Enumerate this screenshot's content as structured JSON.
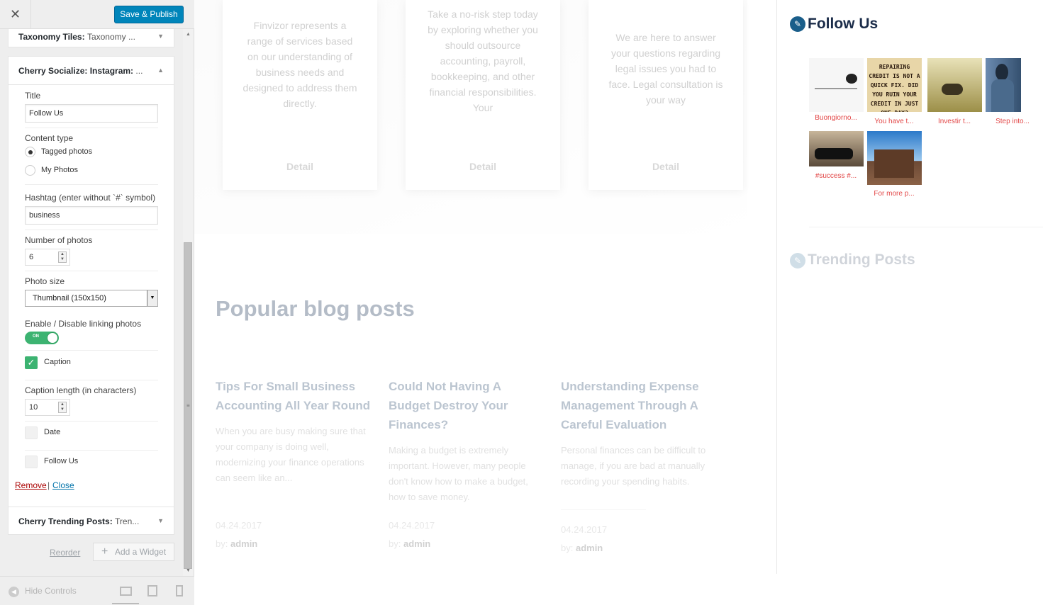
{
  "topbar": {
    "close_glyph": "✕",
    "publish_label": "Save & Publish"
  },
  "widgets": {
    "taxonomy": {
      "title": "Taxonomy Tiles:",
      "subtitle": "Taxonomy ..."
    },
    "instagram": {
      "title": "Cherry Socialize: Instagram:",
      "subtitle": "...",
      "title_label": "Title",
      "title_value": "Follow Us",
      "content_type_label": "Content type",
      "content_types": [
        "Tagged photos",
        "My Photos"
      ],
      "content_type_selected": "Tagged photos",
      "hashtag_label": "Hashtag (enter without `#` symbol)",
      "hashtag_value": "business",
      "num_photos_label": "Number of photos",
      "num_photos_value": "6",
      "photo_size_label": "Photo size",
      "photo_size_value": "Thumbnail (150x150)",
      "linking_label": "Enable / Disable linking photos",
      "linking_toggle": "ON",
      "caption_label": "Caption",
      "caption_checked": true,
      "caption_length_label": "Caption length (in characters)",
      "caption_length_value": "10",
      "date_label": "Date",
      "date_checked": false,
      "follow_label": "Follow Us",
      "follow_checked": false,
      "remove_link": "Remove",
      "divider": "|",
      "close_link": "Close"
    },
    "trending": {
      "title": "Cherry Trending Posts:",
      "subtitle": "Tren..."
    }
  },
  "actions": {
    "reorder": "Reorder",
    "add_widget": "Add a Widget"
  },
  "footer": {
    "hide_controls": "Hide Controls"
  },
  "preview": {
    "services": [
      {
        "text": "Finvizor represents a range of services based on our understanding of business needs and designed to address them directly.",
        "button": "Detail"
      },
      {
        "text": "Take a no-risk step today by exploring whether you should outsource accounting, payroll, bookkeeping, and other financial responsibilities. Your",
        "button": "Detail"
      },
      {
        "text": "We are here to answer your questions regarding legal issues you had to face. Legal consultation is your way",
        "button": "Detail"
      }
    ],
    "blog_title": "Popular blog posts",
    "posts": [
      {
        "title": "Tips For Small Business Accounting All Year Round",
        "excerpt": "When you are busy making sure that your company is doing well, modernizing your finance operations can seem like an...",
        "date": "04.24.2017",
        "by": "by:",
        "author": "admin"
      },
      {
        "title": "Could Not Having A Budget Destroy Your Finances?",
        "excerpt": "Making a budget is extremely important. However, many people don't know how to make a budget, how to save money.",
        "date": "04.24.2017",
        "by": "by:",
        "author": "admin"
      },
      {
        "title": "Understanding Expense Management Through A Careful Evaluation",
        "excerpt": "Personal finances can be difficult to manage, if you are bad at manually recording your spending habits.",
        "date": "04.24.2017",
        "by": "by:",
        "author": "admin"
      }
    ],
    "follow_title": "Follow Us",
    "photos": [
      {
        "caption": "Buongiorno...",
        "alt": "photo-1"
      },
      {
        "caption": "You have t...",
        "alt": "photo-2",
        "overlay": "REPAIRING CREDIT IS NOT A QUICK FIX. DID YOU RUIN YOUR CREDIT IN JUST ONE DAY?"
      },
      {
        "caption": "Investir t...",
        "alt": "photo-3"
      },
      {
        "caption": "Step into...",
        "alt": "photo-4"
      },
      {
        "caption": "#success #...",
        "alt": "photo-5"
      },
      {
        "caption": "For more p...",
        "alt": "photo-6"
      }
    ],
    "trending_title": "Trending Posts"
  },
  "icons": {
    "widget_icon": "pencil-circle-icon"
  },
  "colors": {
    "accent": "#0085ba",
    "toggle_on": "#3cb371",
    "caption_red": "#e24747",
    "heading_dark": "#1b2c49"
  }
}
